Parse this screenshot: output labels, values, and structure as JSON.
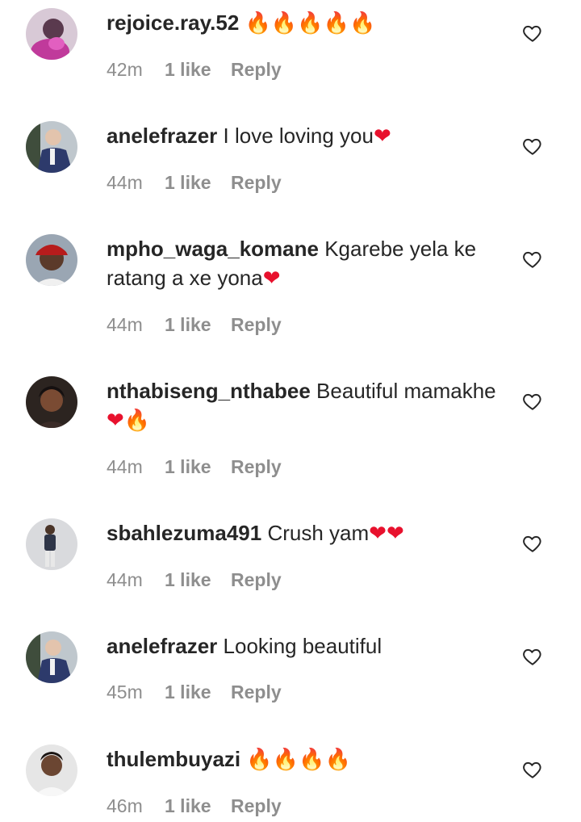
{
  "comments": [
    {
      "username": "rejoice.ray.52",
      "text": " ",
      "emojis": [
        "🔥",
        "🔥",
        "🔥",
        "🔥",
        "🔥"
      ],
      "time": "42m",
      "likes": "1 like",
      "reply": "Reply",
      "avatar_icon": "avatar-photo-purple"
    },
    {
      "username": "anelefrazer",
      "text": " I love loving you",
      "emojis": [
        "❤"
      ],
      "time": "44m",
      "likes": "1 like",
      "reply": "Reply",
      "avatar_icon": "avatar-photo-suit"
    },
    {
      "username": "mpho_waga_komane",
      "text": " Kgarebe yela ke ratang a xe yona",
      "emojis": [
        "❤"
      ],
      "time": "44m",
      "likes": "1 like",
      "reply": "Reply",
      "avatar_icon": "avatar-photo-cap"
    },
    {
      "username": "nthabiseng_nthabee",
      "text": " Beautiful mamakhe ",
      "emojis": [
        "❤",
        "🔥"
      ],
      "time": "44m",
      "likes": "1 like",
      "reply": "Reply",
      "avatar_icon": "avatar-photo-woman"
    },
    {
      "username": "sbahlezuma491",
      "text": " Crush yam",
      "emojis": [
        "❤",
        "❤"
      ],
      "time": "44m",
      "likes": "1 like",
      "reply": "Reply",
      "avatar_icon": "avatar-photo-standing"
    },
    {
      "username": "anelefrazer",
      "text": " Looking beautiful",
      "emojis": [],
      "time": "45m",
      "likes": "1 like",
      "reply": "Reply",
      "avatar_icon": "avatar-photo-suit"
    },
    {
      "username": "thulembuyazi",
      "text": " ",
      "emojis": [
        "🔥",
        "🔥",
        "🔥",
        "🔥"
      ],
      "time": "46m",
      "likes": "1 like",
      "reply": "Reply",
      "avatar_icon": "avatar-photo-woman-light"
    }
  ],
  "colors": {
    "text": "#262626",
    "meta": "#8e8e8e",
    "fire": "#f7931e",
    "heart": "#e8112d"
  },
  "icons": {
    "like": "heart-outline-icon"
  }
}
